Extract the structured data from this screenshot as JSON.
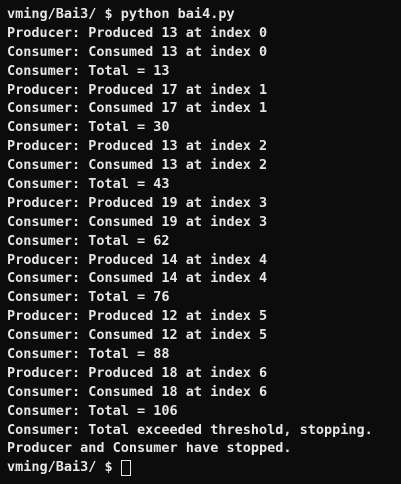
{
  "terminal": {
    "lines": [
      "vming/Bai3/ $ python bai4.py",
      "Producer: Produced 13 at index 0",
      "Consumer: Consumed 13 at index 0",
      "Consumer: Total = 13",
      "Producer: Produced 17 at index 1",
      "Consumer: Consumed 17 at index 1",
      "Consumer: Total = 30",
      "Producer: Produced 13 at index 2",
      "Consumer: Consumed 13 at index 2",
      "Consumer: Total = 43",
      "Producer: Produced 19 at index 3",
      "Consumer: Consumed 19 at index 3",
      "Consumer: Total = 62",
      "Producer: Produced 14 at index 4",
      "Consumer: Consumed 14 at index 4",
      "Consumer: Total = 76",
      "Producer: Produced 12 at index 5",
      "Consumer: Consumed 12 at index 5",
      "Consumer: Total = 88",
      "Producer: Produced 18 at index 6",
      "Consumer: Consumed 18 at index 6",
      "Consumer: Total = 106",
      "Consumer: Total exceeded threshold, stopping.",
      "Producer and Consumer have stopped."
    ],
    "prompt": "vming/Bai3/ $",
    "colors": {
      "background": "#0c0c0c",
      "text": "#e6e6e6"
    }
  }
}
